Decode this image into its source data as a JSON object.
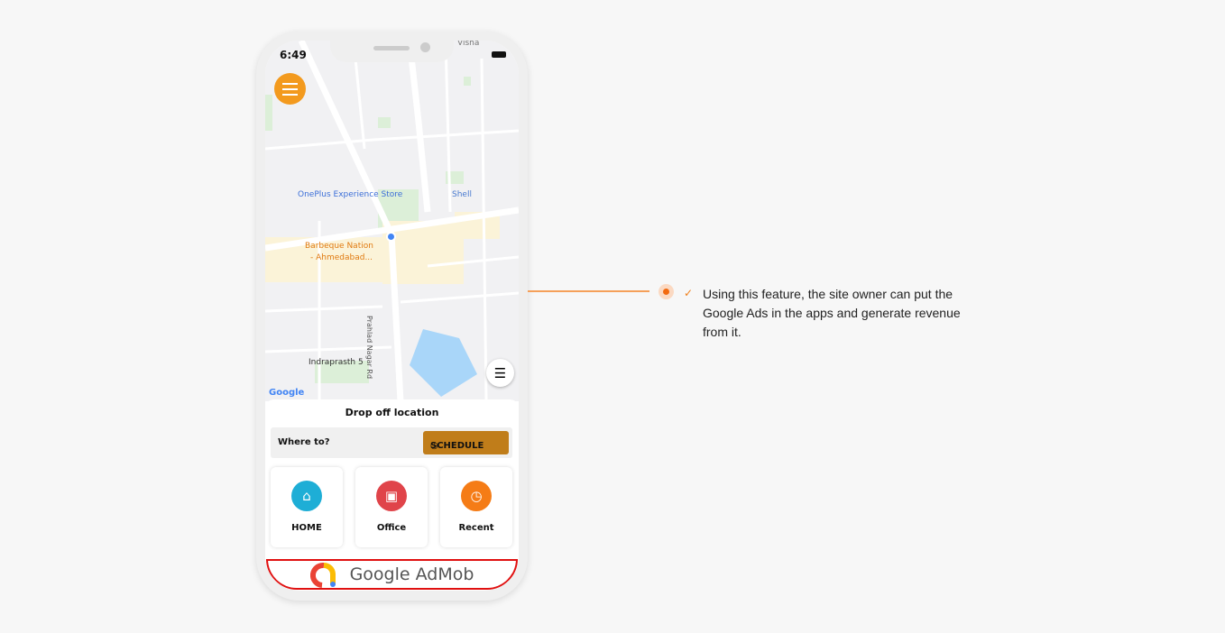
{
  "status": {
    "time": "6:49"
  },
  "map": {
    "labels": {
      "top": "Visha",
      "oneplus": "OnePlus Experience Store",
      "shell": "Shell",
      "bbq1": "Barbeque Nation",
      "bbq2": "- Ahmedabad...",
      "road": "Prahlad Nagar Rd",
      "indra": "Indraprasth 5",
      "google": "Google"
    }
  },
  "sheet": {
    "title": "Drop off location",
    "where": "Where to?",
    "schedule": "SCHEDULE",
    "cards": [
      {
        "label": "HOME",
        "icon": "home-icon",
        "color": "#1eaed6"
      },
      {
        "label": "Office",
        "icon": "briefcase-icon",
        "color": "#e0444a"
      },
      {
        "label": "Recent",
        "icon": "history-icon",
        "color": "#f57c16"
      }
    ]
  },
  "ad": {
    "text": "Google AdMob"
  },
  "feature": {
    "text": "Using this feature, the site owner can put the Google Ads in the apps and generate revenue from it.",
    "accent": "#f26a10"
  }
}
